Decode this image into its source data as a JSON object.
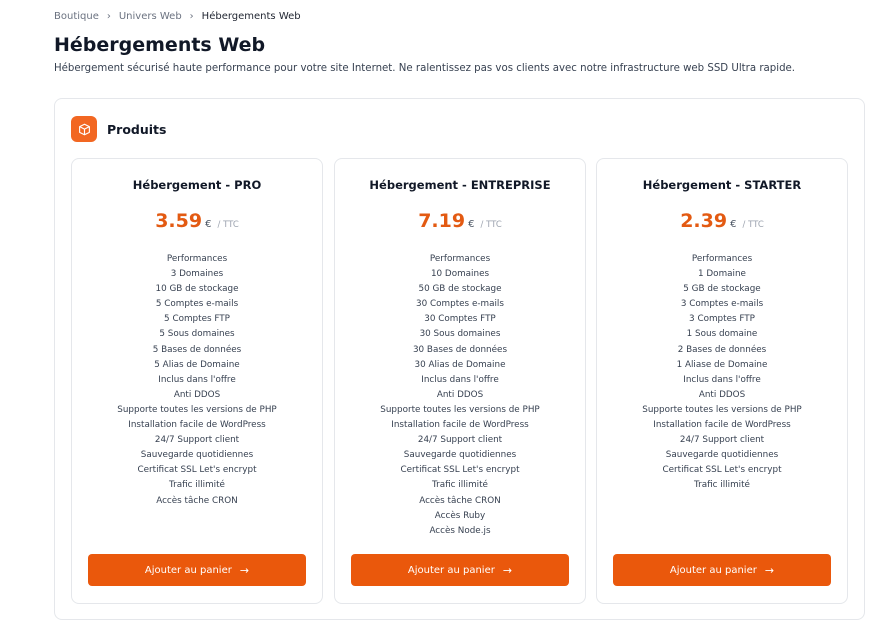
{
  "breadcrumb": {
    "items": [
      "Boutique",
      "Univers Web",
      "Hébergements Web"
    ]
  },
  "page": {
    "title": "Hébergements Web",
    "subtitle": "Hébergement sécurisé haute performance pour votre site Internet. Ne ralentissez pas vos clients avec notre infrastructure web SSD Ultra rapide."
  },
  "panel": {
    "title": "Produits",
    "icon": "box-icon",
    "accent_color": "#f26722"
  },
  "products": [
    {
      "name": "Hébergement - PRO",
      "price": "3.59",
      "currency": "€",
      "tax": "/ TTC",
      "features": [
        "Performances",
        "3 Domaines",
        "10 GB de stockage",
        "5 Comptes e-mails",
        "5 Comptes FTP",
        "5 Sous domaines",
        "5 Bases de données",
        "5 Alias de Domaine",
        "Inclus dans l'offre",
        "Anti DDOS",
        "Supporte toutes les versions de PHP",
        "Installation facile de WordPress",
        "24/7 Support client",
        "Sauvegarde quotidiennes",
        "Certificat SSL Let's encrypt",
        "Trafic illimité",
        "Accès tâche CRON"
      ],
      "button": "Ajouter au panier"
    },
    {
      "name": "Hébergement - ENTREPRISE",
      "price": "7.19",
      "currency": "€",
      "tax": "/ TTC",
      "features": [
        "Performances",
        "10 Domaines",
        "50 GB de stockage",
        "30 Comptes e-mails",
        "30 Comptes FTP",
        "30 Sous domaines",
        "30 Bases de données",
        "30 Alias de Domaine",
        "Inclus dans l'offre",
        "Anti DDOS",
        "Supporte toutes les versions de PHP",
        "Installation facile de WordPress",
        "24/7 Support client",
        "Sauvegarde quotidiennes",
        "Certificat SSL Let's encrypt",
        "Trafic illimité",
        "Accès tâche CRON",
        "Accès Ruby",
        "Accès Node.js"
      ],
      "button": "Ajouter au panier"
    },
    {
      "name": "Hébergement - STARTER",
      "price": "2.39",
      "currency": "€",
      "tax": "/ TTC",
      "features": [
        "Performances",
        "1 Domaine",
        "5 GB de stockage",
        "3 Comptes e-mails",
        "3 Comptes FTP",
        "1 Sous domaine",
        "2 Bases de données",
        "1 Aliase de Domaine",
        "Inclus dans l'offre",
        "Anti DDOS",
        "Supporte toutes les versions de PHP",
        "Installation facile de WordPress",
        "24/7 Support client",
        "Sauvegarde quotidiennes",
        "Certificat SSL Let's encrypt",
        "Trafic illimité"
      ],
      "button": "Ajouter au panier"
    }
  ],
  "colors": {
    "price": "#e35a12",
    "button": "#ea580c"
  }
}
